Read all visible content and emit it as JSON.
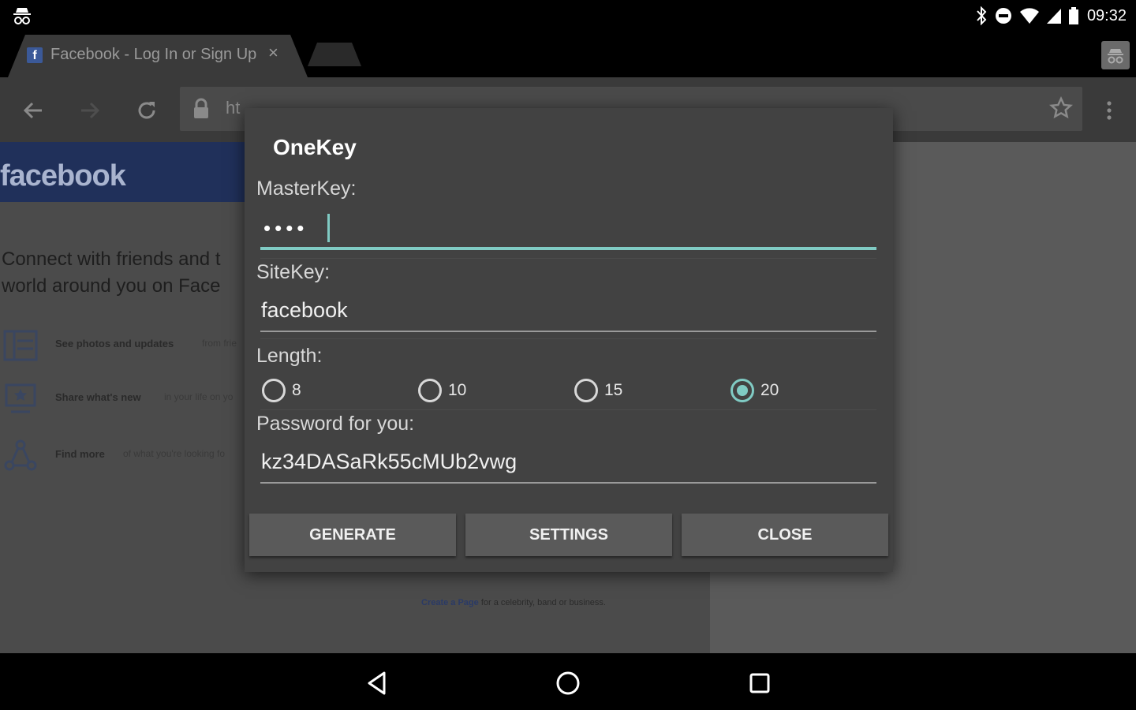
{
  "status_bar": {
    "left_icon": "incognito-icon",
    "icons": [
      "bluetooth-icon",
      "do-not-disturb-icon",
      "wifi-icon",
      "cell-signal-icon",
      "battery-icon"
    ],
    "time": "09:32"
  },
  "browser": {
    "tab": {
      "title": "Facebook - Log In or Sign Up",
      "favicon": "f"
    },
    "url": "https://www.facebook.com",
    "url_visible": "ht"
  },
  "page": {
    "logo": "facebook",
    "tagline": "Connect with friends and t world around you on Face",
    "features": [
      {
        "title": "See photos and updates",
        "sub": "from frie"
      },
      {
        "title": "Share what's new",
        "sub": "in your life on yo"
      },
      {
        "title": "Find more",
        "sub": "of what you're looking fo"
      }
    ],
    "create_page": {
      "link": "Create a Page",
      "rest": "for a celebrity, band or business."
    }
  },
  "dialog": {
    "title": "OneKey",
    "master_key_label": "MasterKey:",
    "master_key_masked": "••••",
    "site_key_label": "SiteKey:",
    "site_key_value": "facebook",
    "length_label": "Length:",
    "length_options": [
      "8",
      "10",
      "15",
      "20"
    ],
    "length_selected": "20",
    "password_label": "Password for you:",
    "password_value": "kz34DASaRk55cMUb2vwg",
    "buttons": {
      "generate": "GENERATE",
      "settings": "SETTINGS",
      "close": "CLOSE"
    }
  },
  "colors": {
    "accent": "#80cbc4",
    "dialog_bg": "#424242",
    "button_bg": "#5a5a5a"
  }
}
